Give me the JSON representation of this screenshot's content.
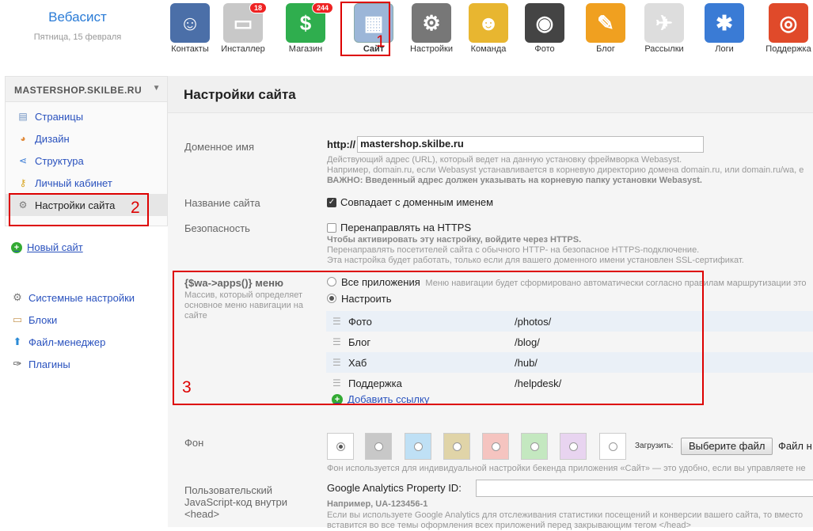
{
  "brand": {
    "name": "Вебасист",
    "date": "Пятница, 15 февраля"
  },
  "apps": [
    {
      "label": "Контакты",
      "icon": "contacts-icon",
      "color": "#4b6fa8",
      "glyph": "☺",
      "badge": ""
    },
    {
      "label": "Инсталлер",
      "icon": "installer-icon",
      "color": "#c8c8c8",
      "glyph": "▭",
      "badge": "18"
    },
    {
      "label": "Магазин",
      "icon": "shop-icon",
      "color": "#2fae4e",
      "glyph": "$",
      "badge": "244"
    },
    {
      "label": "Сайт",
      "icon": "site-icon",
      "color": "#9cb6d8",
      "glyph": "▦",
      "badge": ""
    },
    {
      "label": "Настройки",
      "icon": "settings-icon",
      "color": "#777777",
      "glyph": "⚙",
      "badge": ""
    },
    {
      "label": "Команда",
      "icon": "team-icon",
      "color": "#e8b630",
      "glyph": "☻",
      "badge": ""
    },
    {
      "label": "Фото",
      "icon": "camera-icon",
      "color": "#444444",
      "glyph": "◉",
      "badge": ""
    },
    {
      "label": "Блог",
      "icon": "pencil-icon",
      "color": "#f0a020",
      "glyph": "✎",
      "badge": ""
    },
    {
      "label": "Рассылки",
      "icon": "mailer-icon",
      "color": "#dddddd",
      "glyph": "✈",
      "badge": ""
    },
    {
      "label": "Логи",
      "icon": "logs-icon",
      "color": "#3a7bd5",
      "glyph": "✱",
      "badge": ""
    },
    {
      "label": "Поддержка",
      "icon": "lifebuoy-icon",
      "color": "#e04a2a",
      "glyph": "◎",
      "badge": ""
    }
  ],
  "sidebar": {
    "site_name": "MASTERSHOP.SKILBE.RU",
    "items": [
      "Страницы",
      "Дизайн",
      "Структура",
      "Личный кабинет",
      "Настройки сайта"
    ],
    "new_site": "Новый сайт",
    "system": [
      "Системные настройки",
      "Блоки",
      "Файл-менеджер",
      "Плагины"
    ]
  },
  "main": {
    "title": "Настройки сайта",
    "domain": {
      "label": "Доменное имя",
      "prefix": "http://",
      "value": "mastershop.skilbe.ru",
      "hint1": "Действующий адрес (URL), который ведет на данную установку фреймворка Webasyst.",
      "hint2": "Например, domain.ru, если Webasyst устанавливается в корневую директорию домена domain.ru, или domain.ru/wa, е",
      "hint3": "ВАЖНО: Введенный адрес должен указывать на корневую папку установки Webasyst."
    },
    "sitename": {
      "label": "Название сайта",
      "option": "Совпадает с доменным именем"
    },
    "security": {
      "label": "Безопасность",
      "option": "Перенаправлять на HTTPS",
      "hint1": "Чтобы активировать эту настройку, войдите через HTTPS.",
      "hint2": "Перенаправлять посетителей сайта с обычного HTTP- на безопасное HTTPS-подключение.",
      "hint3": "Эта настройка будет работать, только если для вашего доменного имени установлен SSL-сертификат."
    },
    "menu": {
      "label": "{$wa->apps()} меню",
      "hint": "Массив, который определяет основное меню навигации на сайте",
      "opt_all": "Все приложения",
      "opt_all_hint": "Меню навигации будет сформировано автоматически согласно правилам маршрутизации это",
      "opt_custom": "Настроить",
      "links": [
        {
          "name": "Фото",
          "url": "/photos/"
        },
        {
          "name": "Блог",
          "url": "/blog/"
        },
        {
          "name": "Хаб",
          "url": "/hub/"
        },
        {
          "name": "Поддержка",
          "url": "/helpdesk/"
        }
      ],
      "add_link": "Добавить ссылку"
    },
    "bg": {
      "label": "Фон",
      "upload": "Загрузить:",
      "button": "Выберите файл",
      "file_text": "Файл н",
      "swatches": [
        "#ffffff",
        "#c8c8c8",
        "#bfe0f5",
        "#e0d4a8",
        "#f5c4c0",
        "#c4e8c0",
        "#e8d4f0",
        "#ffffff"
      ],
      "hint": "Фон используется для индивидуальной настройки бекенда приложения «Сайт» — это удобно, если вы управляете не"
    },
    "ga": {
      "label": "Пользовательский JavaScript-код внутри <head>",
      "field_label": "Google Analytics Property ID:",
      "example": "Например, UA-123456-1",
      "hint2": "Если вы используете Google Analytics для отслеживания статистики посещений и конверсии вашего сайта, то вместо",
      "hint3": "вставится во все темы оформления всех приложений перед закрывающим тегом </head>"
    }
  },
  "annotations": [
    "1",
    "2",
    "3"
  ]
}
